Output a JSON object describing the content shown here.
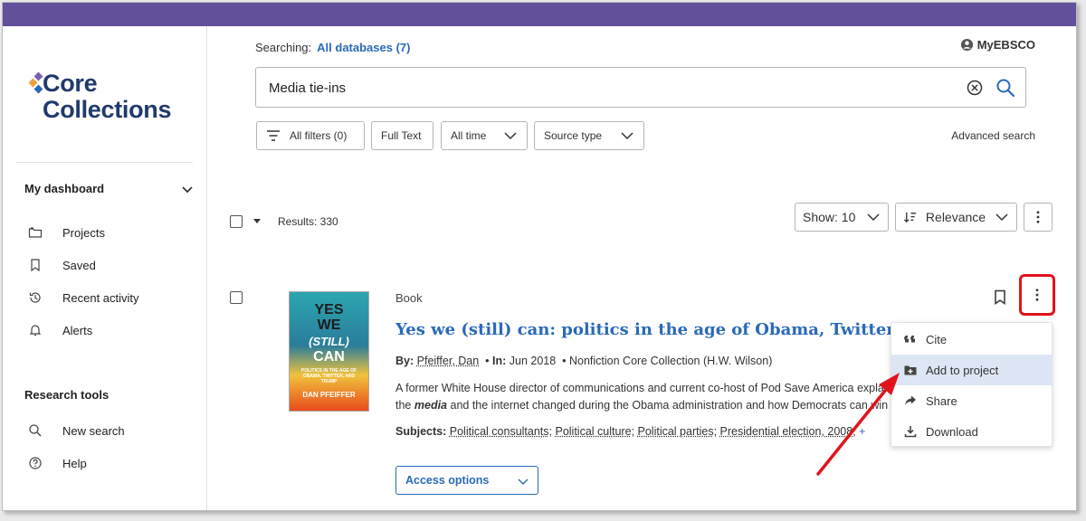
{
  "brand": {
    "line1": "Core",
    "line2": "Collections",
    "dot_colors": [
      "#7b5fb3",
      "#e9a23b",
      "#2a6ab8"
    ]
  },
  "sidebar": {
    "dashboard_label": "My dashboard",
    "items": [
      {
        "label": "Projects",
        "icon": "folder-icon"
      },
      {
        "label": "Saved",
        "icon": "bookmark-icon"
      },
      {
        "label": "Recent activity",
        "icon": "history-icon"
      },
      {
        "label": "Alerts",
        "icon": "bell-icon"
      }
    ],
    "tools_label": "Research tools",
    "tools": [
      {
        "label": "New search",
        "icon": "search-icon"
      },
      {
        "label": "Help",
        "icon": "help-icon"
      }
    ]
  },
  "header": {
    "searching_label": "Searching:",
    "databases": "All databases (7)",
    "account": "MyEBSCO"
  },
  "search": {
    "query": "Media tie-ins"
  },
  "filters": {
    "all_filters": "All filters (0)",
    "full_text": "Full Text",
    "time": "All time",
    "source_type": "Source type",
    "advanced": "Advanced search"
  },
  "results_bar": {
    "count": "Results: 330",
    "show": "Show: 10",
    "sort": "Relevance"
  },
  "result": {
    "type": "Book",
    "title": "Yes we (still) can: politics in the age of Obama, Twitter, and Trump",
    "by_label": "By:",
    "author": "Pfeiffer, Dan",
    "in_label": "In:",
    "date": "Jun 2018",
    "source": "Nonfiction Core Collection (H.W. Wilson)",
    "abstract_1": "A former White House director of communications and current co-host of Pod Save America explains how",
    "abstract_2_em": "media",
    "abstract_2_pre": "the",
    "abstract_2_post": "and the internet changed during the Obama administration and how Democrats can win",
    "subjects_label": "Subjects:",
    "subjects": [
      "Political consultants",
      "Political culture",
      "Political parties",
      "Presidential election, 2008"
    ],
    "subjects_more": "+",
    "access": "Access options",
    "cover": {
      "l1": "YES",
      "l2": "WE",
      "l3": "(STILL)",
      "l4": "CAN",
      "sub": "POLITICS IN THE AGE OF OBAMA, TWITTER, AND TRUMP",
      "author": "DAN PFEIFFER"
    }
  },
  "menu": {
    "items": [
      {
        "label": "Cite",
        "icon": "quote-icon"
      },
      {
        "label": "Add to project",
        "icon": "folder-plus-icon"
      },
      {
        "label": "Share",
        "icon": "share-icon"
      },
      {
        "label": "Download",
        "icon": "download-icon"
      }
    ]
  },
  "colors": {
    "topbar": "#62509c",
    "link": "#2a6ab8",
    "highlight": "#e0141b",
    "menu_active": "#dde6f4"
  }
}
